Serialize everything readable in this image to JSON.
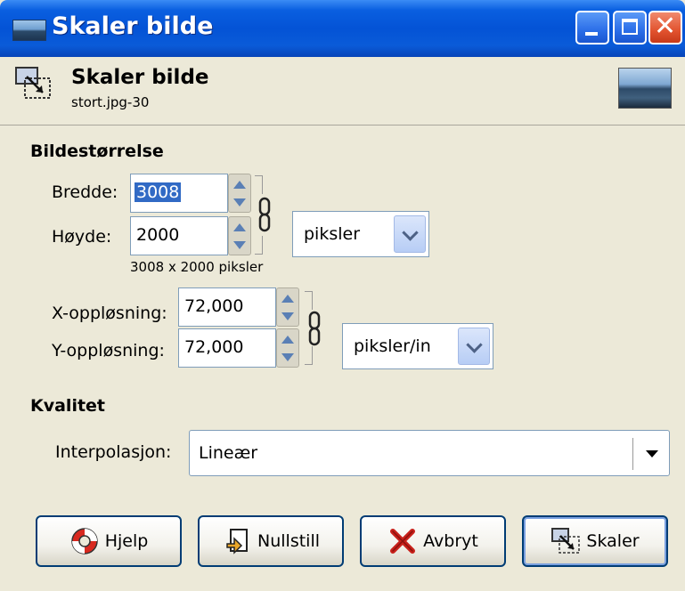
{
  "window": {
    "title": "Skaler bilde"
  },
  "header": {
    "title": "Skaler bilde",
    "subtitle": "stort.jpg-30"
  },
  "image_size": {
    "section_title": "Bildestørrelse",
    "width_label": "Bredde:",
    "width_value": "3008",
    "height_label": "Høyde:",
    "height_value": "2000",
    "unit_value": "piksler",
    "summary": "3008 x 2000 piksler",
    "xres_label": "X-oppløsning:",
    "xres_value": "72,000",
    "yres_label": "Y-oppløsning:",
    "yres_value": "72,000",
    "res_unit_value": "piksler/in"
  },
  "quality": {
    "section_title": "Kvalitet",
    "interpolation_label": "Interpolasjon:",
    "interpolation_value": "Lineær"
  },
  "buttons": {
    "help": "Hjelp",
    "reset": "Nullstill",
    "cancel": "Avbryt",
    "scale": "Skaler"
  }
}
